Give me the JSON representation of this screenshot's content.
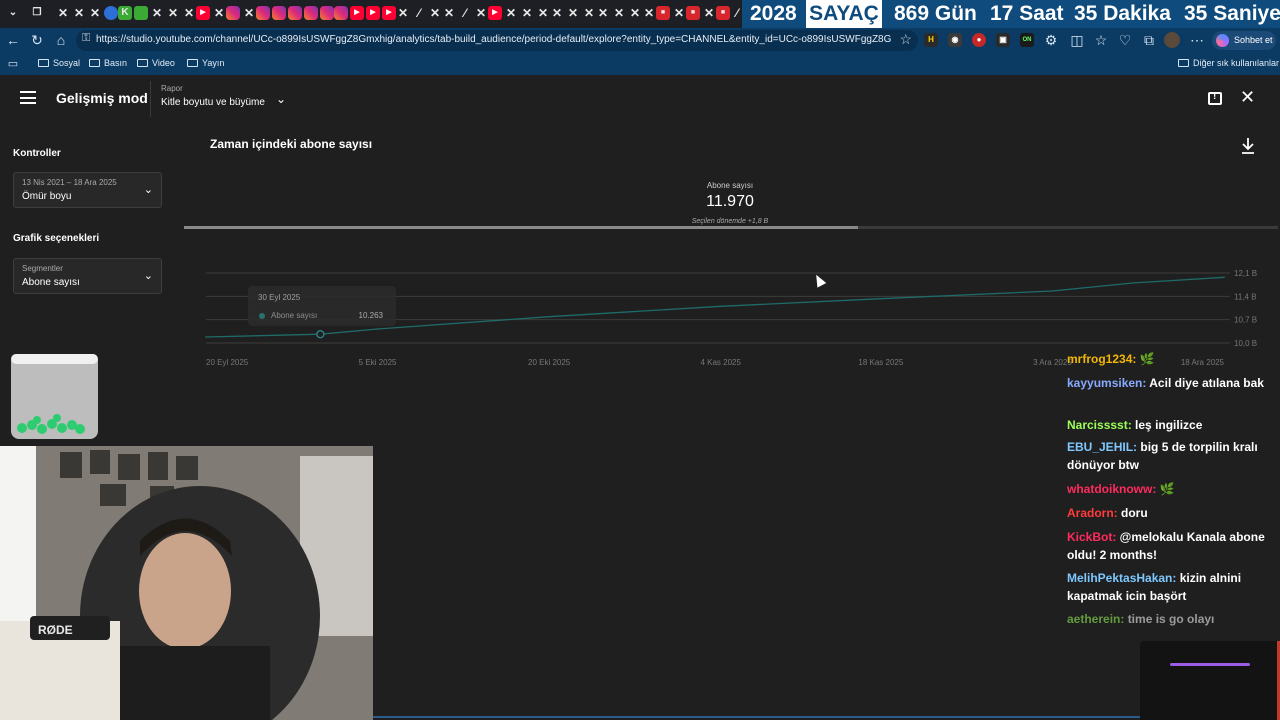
{
  "browser": {
    "url": "https://studio.youtube.com/channel/UCc-o899IsUSWFggZ8Gmxhig/analytics/tab-build_audience/period-default/explore?entity_type=CHANNEL&entity_id=UCc-o899IsUSWFggZ8Gmxhig&tim...",
    "chat_button": "Sohbet et",
    "bookmarks": [
      "Sosyal",
      "Basın",
      "Video",
      "Yayın"
    ],
    "other_bookmarks": "Diğer sık kullanılanlar"
  },
  "counter": {
    "year": "2028",
    "label": "SAYAÇ",
    "days": "869 Gün",
    "hours": "17 Saat",
    "minutes": "35 Dakika",
    "seconds": "35 Saniye"
  },
  "studio": {
    "mode_title": "Gelişmiş mod",
    "report_label": "Rapor",
    "report_value": "Kitle boyutu ve büyüme",
    "controls_heading": "Kontroller",
    "range_small": "13 Nis 2021 – 18 Ara 2025",
    "range_main": "Ömür boyu",
    "chart_options_heading": "Grafik seçenekleri",
    "segment_small": "Segmentler",
    "segment_main": "Abone sayısı"
  },
  "metric": {
    "label": "Abone sayısı",
    "value": "11.970",
    "delta": "Seçilen dönemde +1,8 B"
  },
  "tooltip": {
    "date": "30 Eyl 2025",
    "series": "Abone sayısı",
    "value": "10.263"
  },
  "chart_data": {
    "type": "line",
    "title": "Zaman içindeki abone sayısı",
    "series_name": "Abone sayısı",
    "x_ticks": [
      "20 Eyl 2025",
      "5 Eki 2025",
      "20 Eki 2025",
      "4 Kas 2025",
      "18 Kas 2025",
      "3 Ara 2025",
      "18 Ara 2025"
    ],
    "y_ticks": [
      "10,0 B",
      "10,7 B",
      "11,4 B",
      "12,1 B"
    ],
    "ylim": [
      10000,
      12100
    ],
    "x": [
      "2025-09-20",
      "2025-09-30",
      "2025-10-05",
      "2025-10-20",
      "2025-11-04",
      "2025-11-18",
      "2025-12-03",
      "2025-12-10",
      "2025-12-18"
    ],
    "y": [
      10180,
      10263,
      10420,
      10790,
      11100,
      11330,
      11560,
      11800,
      11970
    ]
  },
  "chat": [
    {
      "user": "mrfrog1234",
      "color": "#f2b705",
      "text": "",
      "badge": "🌿"
    },
    {
      "user": "kayyumsiken",
      "color": "#88aaff",
      "text": "Acil diye atılana bak",
      "badge": ""
    },
    {
      "user": "Narcisssst",
      "color": "#9cff57",
      "text": "leş ingilizce",
      "badge": ""
    },
    {
      "user": "EBU_JEHIL",
      "color": "#7ec8ff",
      "text": "big 5 de torpilin kralı dönüyor btw",
      "badge": ""
    },
    {
      "user": "whatdoiknoww",
      "color": "#ff2b5e",
      "text": "",
      "badge": "🌿"
    },
    {
      "user": "Aradorn",
      "color": "#ff3b3b",
      "text": "doru",
      "badge": ""
    },
    {
      "user": "KickBot",
      "color": "#ff2b5e",
      "text": "@melokalu Kanala abone oldu! 2 months!",
      "badge": ""
    },
    {
      "user": "MelihPektasHakan",
      "color": "#7ec8ff",
      "text": "kizin alnini kapatmak icin başört",
      "badge": ""
    },
    {
      "user": "aetherein",
      "color": "#9cff57",
      "text": "time is go olayı",
      "badge": ""
    }
  ]
}
